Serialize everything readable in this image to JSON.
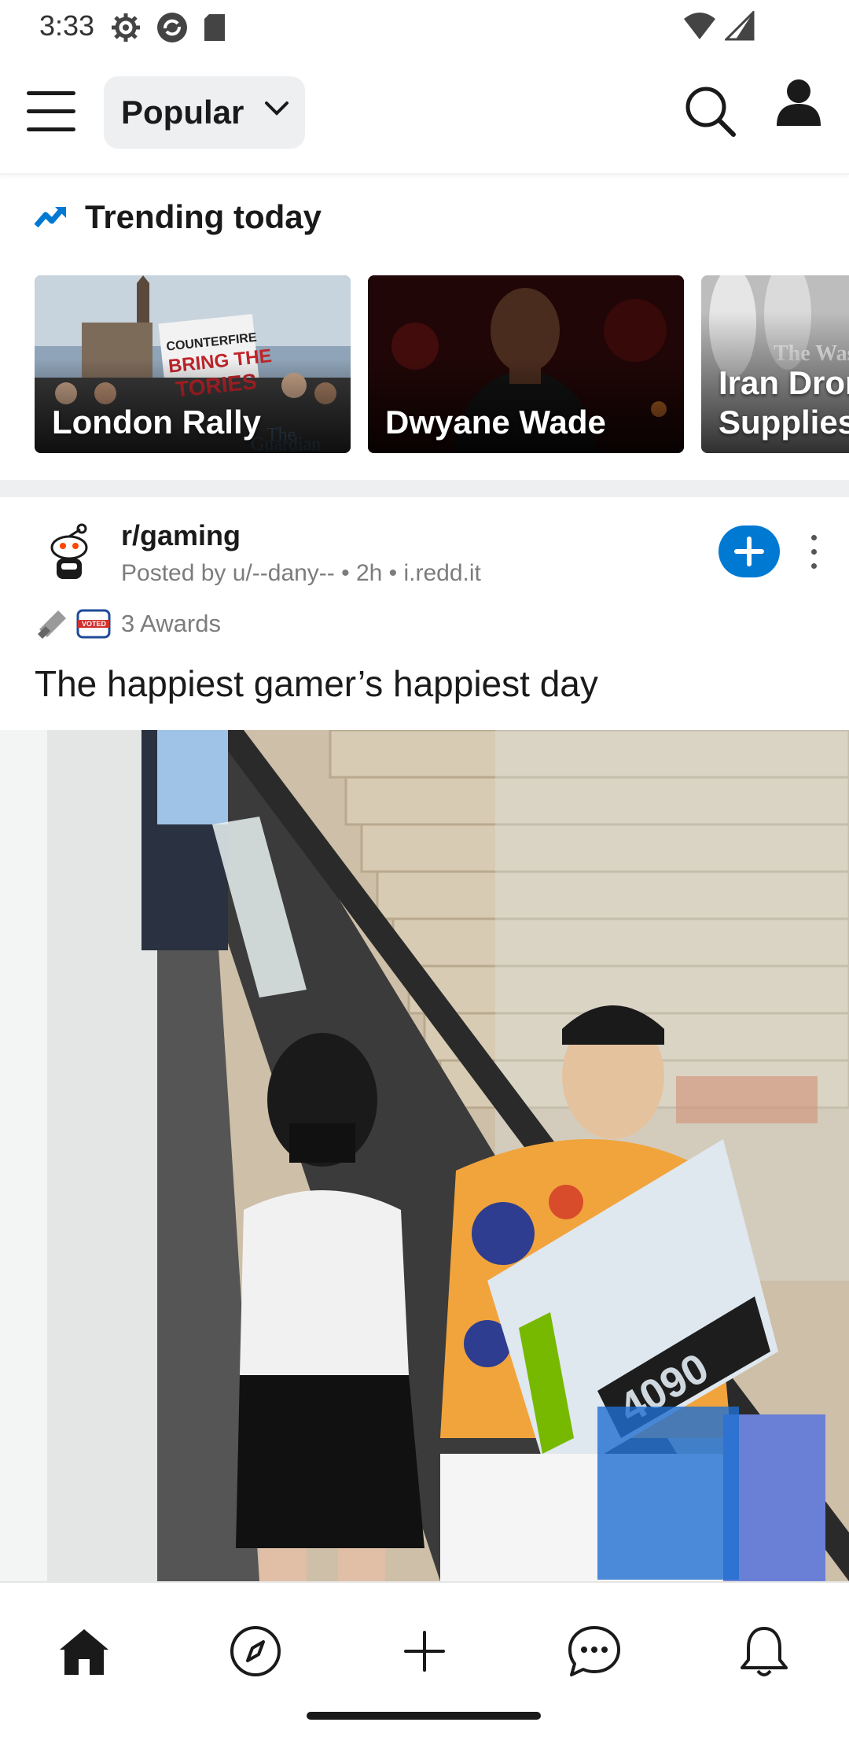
{
  "status_bar": {
    "time": "3:33",
    "icons": [
      "settings-icon",
      "sync-icon",
      "sd-card-icon"
    ],
    "right_icons": [
      "wifi-icon",
      "signal-icon"
    ]
  },
  "header": {
    "feed_selector": "Popular",
    "icons": [
      "menu-icon",
      "chevron-down-icon",
      "search-icon",
      "profile-icon"
    ]
  },
  "trending": {
    "title": "Trending today",
    "cards": [
      {
        "label": "London Rally",
        "watermark": "The Guardian",
        "sign_text": "COUNTERFIRE BRING THE TORIES"
      },
      {
        "label": "Dwyane Wade"
      },
      {
        "label": "Iran Dror\nSupplies",
        "watermark": "The Wash"
      }
    ]
  },
  "post": {
    "subreddit": "r/gaming",
    "meta": "Posted by u/--dany-- • 2h • i.redd.it",
    "awards": "3 Awards",
    "title": "The happiest gamer’s happiest day",
    "image_text": "4090"
  },
  "bottom_nav": {
    "items": [
      "home-icon",
      "explore-icon",
      "create-icon",
      "chat-icon",
      "notifications-icon"
    ]
  },
  "colors": {
    "accent": "#0079d3",
    "trend_icon": "#0079d3",
    "text": "#1a1a1b",
    "muted": "#7c7c7c"
  }
}
